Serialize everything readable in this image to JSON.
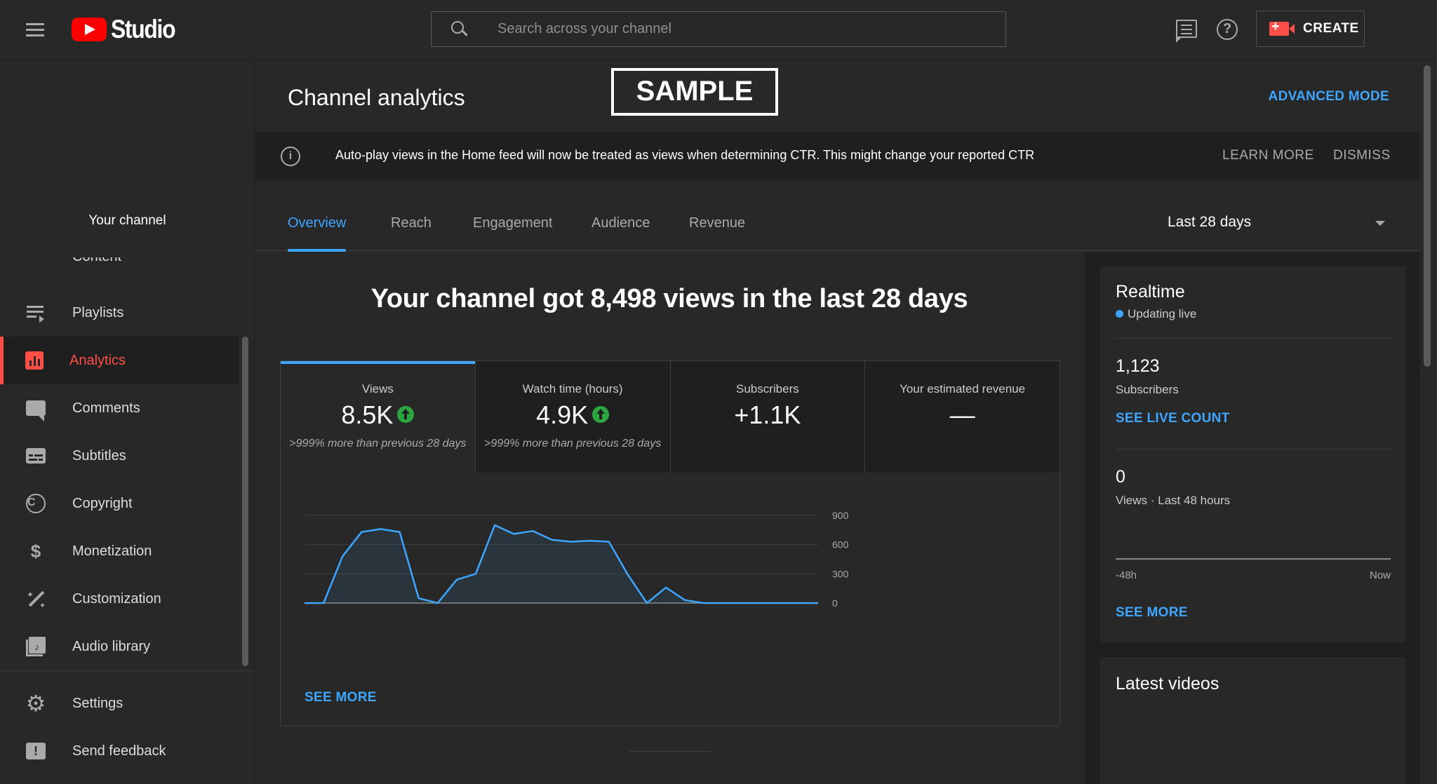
{
  "header": {
    "logo_text": "Studio",
    "search_placeholder": "Search across your channel",
    "create_label": "CREATE",
    "help_glyph": "?"
  },
  "sidebar": {
    "your_channel": "Your channel",
    "partial_item": "Content",
    "items": [
      {
        "label": "Playlists",
        "icon": "playlist-icon"
      },
      {
        "label": "Analytics",
        "icon": "analytics-icon",
        "active": true
      },
      {
        "label": "Comments",
        "icon": "comments-icon"
      },
      {
        "label": "Subtitles",
        "icon": "subtitles-icon"
      },
      {
        "label": "Copyright",
        "icon": "copyright-icon"
      },
      {
        "label": "Monetization",
        "icon": "dollar-icon"
      },
      {
        "label": "Customization",
        "icon": "magic-wand-icon"
      },
      {
        "label": "Audio library",
        "icon": "audio-library-icon"
      }
    ],
    "footer_items": [
      {
        "label": "Settings",
        "icon": "gear-icon"
      },
      {
        "label": "Send feedback",
        "icon": "feedback-icon"
      }
    ]
  },
  "page": {
    "title": "Channel analytics",
    "watermark": "SAMPLE",
    "advanced_mode": "ADVANCED MODE"
  },
  "banner": {
    "text": "Auto-play views in the Home feed will now be treated as views when determining CTR. This might change your reported CTR",
    "learn_more": "LEARN MORE",
    "dismiss": "DISMISS"
  },
  "tabs": [
    "Overview",
    "Reach",
    "Engagement",
    "Audience",
    "Revenue"
  ],
  "active_tab": "Overview",
  "date_range": "Last 28 days",
  "overview": {
    "headline": "Your channel got 8,498 views in the last 28 days",
    "metrics": [
      {
        "label": "Views",
        "value": "8.5K",
        "trend": "up",
        "note": ">999% more than previous 28 days"
      },
      {
        "label": "Watch time (hours)",
        "value": "4.9K",
        "trend": "up",
        "note": ">999% more than previous 28 days"
      },
      {
        "label": "Subscribers",
        "value": "+1.1K",
        "trend": "",
        "note": ""
      },
      {
        "label": "Your estimated revenue",
        "value": "—",
        "trend": "",
        "note": ""
      }
    ],
    "see_more": "SEE MORE"
  },
  "chart_data": {
    "type": "area",
    "title": "",
    "xlabel": "",
    "ylabel": "",
    "y_ticks": [
      "900",
      "600",
      "300",
      "0"
    ],
    "ylim": [
      0,
      900
    ],
    "x": [
      1,
      2,
      3,
      4,
      5,
      6,
      7,
      8,
      9,
      10,
      11,
      12,
      13,
      14,
      15,
      16,
      17,
      18,
      19,
      20,
      21,
      22,
      23,
      24,
      25,
      26,
      27,
      28
    ],
    "series": [
      {
        "values": [
          0,
          0,
          480,
          730,
          760,
          730,
          50,
          0,
          240,
          300,
          800,
          710,
          740,
          650,
          630,
          640,
          630,
          290,
          0,
          160,
          30,
          0,
          0,
          0,
          0,
          0,
          0,
          0
        ]
      }
    ],
    "grid": true,
    "color": "#3ea6ff"
  },
  "realtime": {
    "title": "Realtime",
    "status": "Updating live",
    "subscribers_value": "1,123",
    "subscribers_label": "Subscribers",
    "see_live_count": "SEE LIVE COUNT",
    "views_value": "0",
    "views_label": "Views · Last 48 hours",
    "axis_start": "-48h",
    "axis_end": "Now",
    "see_more": "SEE MORE"
  },
  "latest_videos": {
    "title": "Latest videos"
  },
  "colors": {
    "accent": "#3ea6ff",
    "brand_red": "#ff0000",
    "active_nav": "#ff4e45",
    "trend_up": "#2ba640"
  }
}
